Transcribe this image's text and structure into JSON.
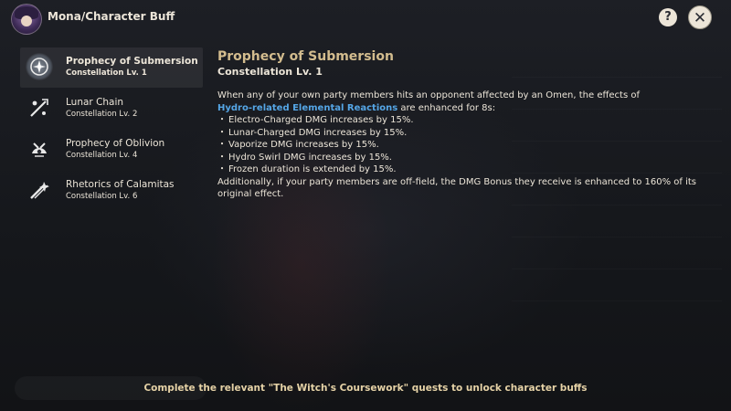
{
  "header": {
    "title": "Mona/Character Buff",
    "help_label": "?",
    "close_label": "✕"
  },
  "constellations": [
    {
      "name": "Prophecy of Submersion",
      "level": "Constellation Lv. 1",
      "selected": true
    },
    {
      "name": "Lunar Chain",
      "level": "Constellation Lv. 2",
      "selected": false
    },
    {
      "name": "Prophecy of Oblivion",
      "level": "Constellation Lv. 4",
      "selected": false
    },
    {
      "name": "Rhetorics of Calamitas",
      "level": "Constellation Lv. 6",
      "selected": false
    }
  ],
  "detail": {
    "title": "Prophecy of Submersion",
    "subtitle": "Constellation Lv. 1",
    "intro_before": "When any of your own party members hits an opponent affected by an Omen, the effects of",
    "intro_highlight": "Hydro-related Elemental Reactions",
    "intro_after": " are enhanced for 8s:",
    "bullets": [
      "Electro-Charged DMG increases by 15%.",
      "Lunar-Charged DMG increases by 15%.",
      "Vaporize DMG increases by 15%.",
      "Hydro Swirl DMG increases by 15%.",
      "Frozen duration is extended by 15%."
    ],
    "outro": "Additionally, if your party members are off-field, the DMG Bonus they receive is enhanced to 160% of its original effect."
  },
  "footer": {
    "hint": "Complete the relevant \"The Witch's Coursework\" quests to unlock character buffs"
  },
  "colors": {
    "accent_gold": "#d3bc8e",
    "hydro_blue": "#55a6e6",
    "text_main": "#ece5d8"
  }
}
